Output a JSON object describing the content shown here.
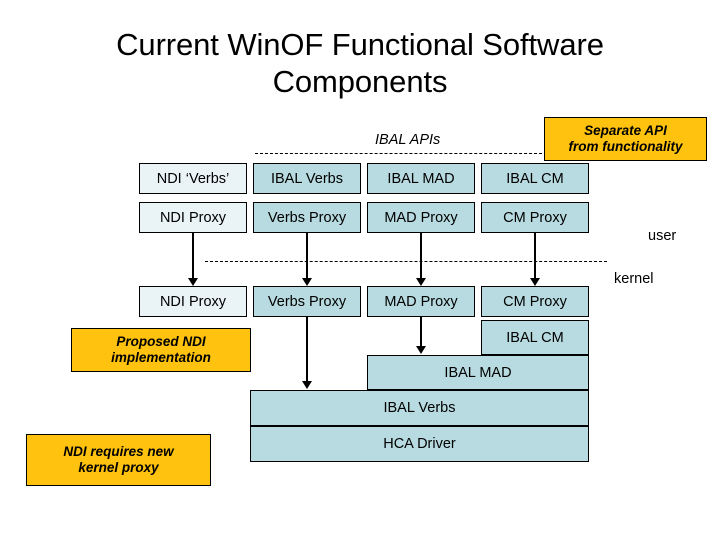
{
  "slide": {
    "title_line1": "Current WinOF Functional Software",
    "title_line2": "Components",
    "colors": {
      "box_fill": "#b7dbe0",
      "box_fill_pale": "#eaf4f6",
      "callout_fill": "#ffc20e",
      "border": "#000000",
      "background": "#ffffff"
    }
  },
  "api_band": {
    "label": "IBAL APIs"
  },
  "callouts": {
    "separate_api": {
      "line1": "Separate API",
      "line2": "from functionality"
    },
    "proposed_ndi": {
      "line1": "Proposed NDI",
      "line2": "implementation"
    },
    "kernel_proxy": {
      "line1": "NDI requires new",
      "line2": "kernel proxy"
    }
  },
  "mode_labels": {
    "user": "user",
    "kernel": "kernel"
  },
  "row_api": [
    {
      "label": "NDI ‘Verbs’",
      "pale": true
    },
    {
      "label": "IBAL Verbs",
      "pale": false
    },
    {
      "label": "IBAL MAD",
      "pale": false
    },
    {
      "label": "IBAL CM",
      "pale": false
    }
  ],
  "row_user_proxy": [
    {
      "label": "NDI Proxy",
      "pale": true
    },
    {
      "label": "Verbs Proxy",
      "pale": false
    },
    {
      "label": "MAD Proxy",
      "pale": false
    },
    {
      "label": "CM Proxy",
      "pale": false
    }
  ],
  "row_kernel_proxy": [
    {
      "label": "NDI Proxy",
      "pale": true
    },
    {
      "label": "Verbs Proxy",
      "pale": false
    },
    {
      "label": "MAD Proxy",
      "pale": false
    },
    {
      "label": "CM Proxy",
      "pale": false
    }
  ],
  "kernel_stack": [
    {
      "label": "IBAL CM"
    },
    {
      "label": "IBAL MAD"
    },
    {
      "label": "IBAL Verbs"
    },
    {
      "label": "HCA Driver"
    }
  ]
}
